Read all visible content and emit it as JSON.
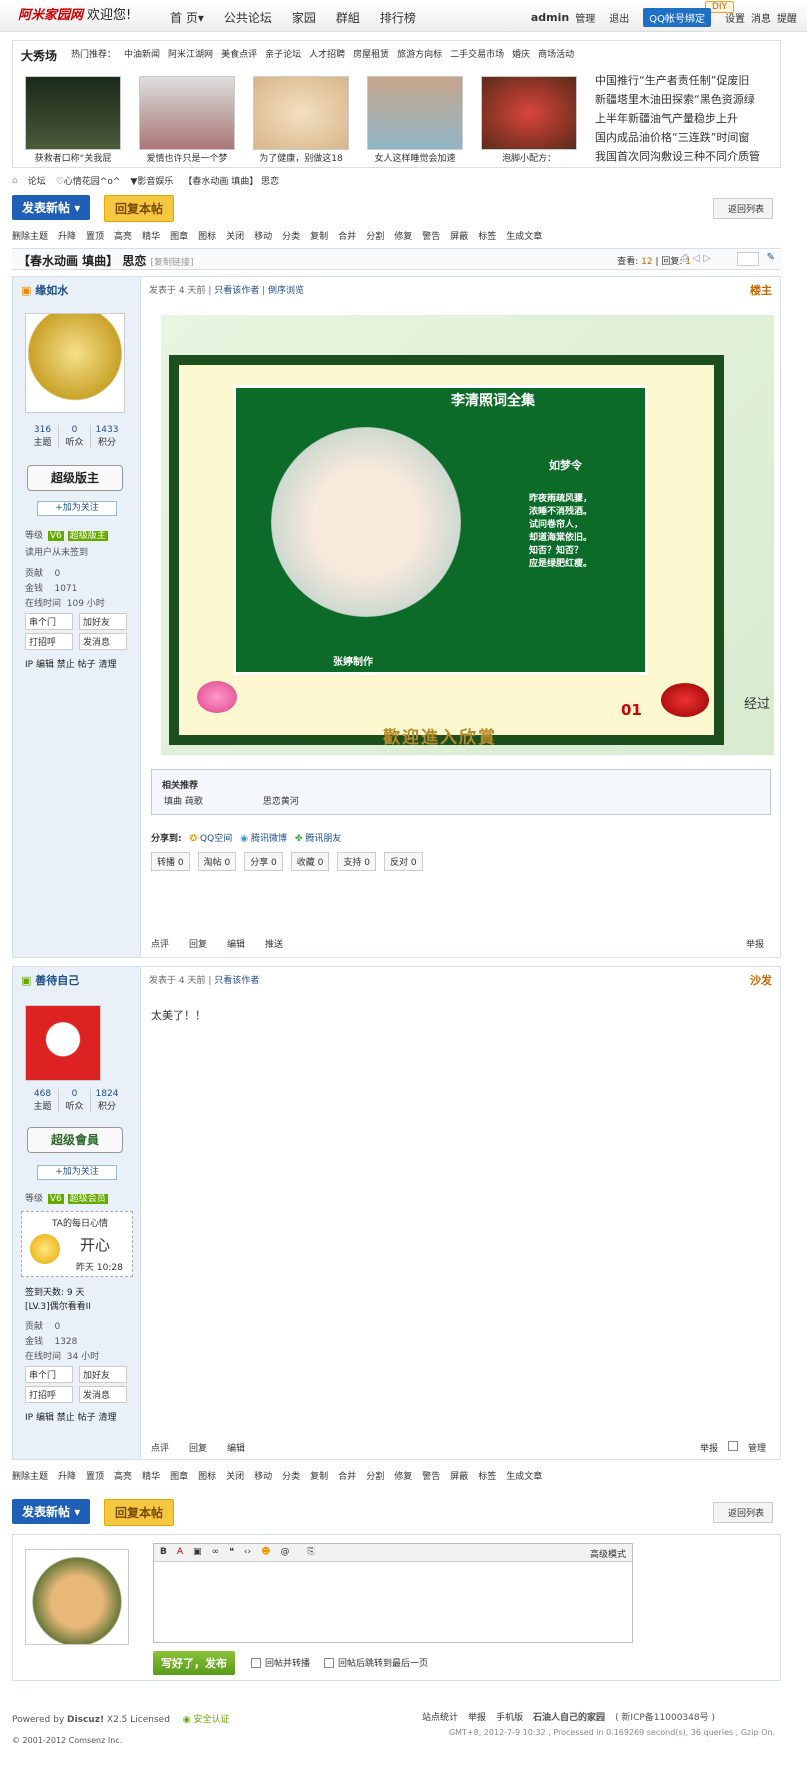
{
  "site": {
    "logo": "阿米家园网",
    "logo_url": "www.adjy.cn",
    "welcome": "欢迎您!"
  },
  "nav": [
    "首 页▾",
    "公共论坛",
    "家园",
    "群組",
    "排行榜"
  ],
  "user": {
    "name": "admin",
    "manage": "管理",
    "logout": "退出",
    "qq": "QQ帐号绑定",
    "diy": "DIY",
    "settings": "设置",
    "msg": "消息",
    "remind": "提醒"
  },
  "show": {
    "title": "大秀场",
    "hot_label": "热门推荐：",
    "hot": [
      "中油新闻",
      "阿米江湖网",
      "美食点评",
      "亲子论坛",
      "人才招聘",
      "房屋租赁",
      "旅游方向标",
      "二手交易市场",
      "婚庆",
      "商场活动"
    ],
    "thumbs": [
      "获救者口称“关我屁",
      "爱情也许只是一个梦",
      "为了健康，别做这18",
      "女人这样睡觉会加速",
      "泡脚小配方："
    ],
    "news": [
      "中国推行“生产者责任制”促废旧",
      "新疆塔里木油田探索“黑色资源绿",
      "上半年新疆油气产量稳步上升",
      "国内成品油价格“三连跌”时间窗",
      "我国首次同沟敷设三种不同介质管"
    ]
  },
  "crumb": [
    "论坛",
    "♡心情花园^o^",
    "▼影音娱乐",
    "【春水动画 填曲】 思恋"
  ],
  "buttons": {
    "new": "发表新帖",
    "reply": "回复本帖",
    "back": "返回列表"
  },
  "mod": [
    "删除主题",
    "升降",
    "置顶",
    "高亮",
    "精华",
    "图章",
    "图标",
    "关闭",
    "移动",
    "分类",
    "复制",
    "合并",
    "分割",
    "修复",
    "警告",
    "屏蔽",
    "标签",
    "生成文章"
  ],
  "thread": {
    "title": "【春水动画 填曲】 思恋",
    "copy": "[复制链接]",
    "view_label": "查看:",
    "views": "12",
    "reply_label": "回复:",
    "replies": "1"
  },
  "post1": {
    "author": "缘如水",
    "posts": "316",
    "fans": "0",
    "points": "1433",
    "stat_labels": [
      "主题",
      "听众",
      "积分"
    ],
    "badge": "超级版主",
    "follow": "+加为关注",
    "level": "等级",
    "vlevel": "V6",
    "group": "超级版主",
    "sign": "读用户从未签到",
    "contrib": "贡献",
    "contrib_v": "0",
    "money": "金钱",
    "money_v": "1071",
    "online": "在线时间",
    "online_v": "109 小时",
    "actions": [
      "串个门",
      "加好友",
      "打招呼",
      "发消息"
    ],
    "admin": "IP 编辑 禁止 帖子 清理",
    "posted": "发表于 4 天前",
    "only": "只看该作者",
    "rev": "倒序浏览",
    "floor": "楼主",
    "image": {
      "title": "李清照词全集",
      "poem_title": "如梦令",
      "poem": [
        "昨夜雨疏风骤，",
        "浓睡不消残酒。",
        "试问卷帘人，",
        "却道海棠依旧。",
        "知否？知否？",
        "应是绿肥红瘦。"
      ],
      "maker": "张婷制作",
      "num": "01",
      "welcome": "歡迎進入欣賞",
      "side": "经过"
    },
    "related_title": "相关推荐",
    "related": [
      "填曲 莼歌",
      "思恋黄河"
    ],
    "share_label": "分享到:",
    "share": [
      "QQ空间",
      "腾讯微博",
      "腾讯朋友"
    ],
    "share_btns": [
      "转播 0",
      "淘帖 0",
      "分享 0",
      "收藏 0",
      "支持 0",
      "反对 0"
    ],
    "foot": [
      "点评",
      "回复",
      "编辑",
      "推送"
    ],
    "report": "举报"
  },
  "post2": {
    "author": "善待自己",
    "posts": "468",
    "fans": "0",
    "points": "1824",
    "badge": "超级會員",
    "follow": "+加为关注",
    "level": "等级",
    "vlevel": "V6",
    "group": "超级会员",
    "mood_title": "TA的每日心情",
    "mood": "开心",
    "mood_time": "昨天 10:28",
    "signin": "签到天数: 9 天",
    "lv": "[LV.3]偶尔看看II",
    "contrib_v": "0",
    "money_v": "1328",
    "online_v": "34 小时",
    "posted": "发表于 4 天前",
    "only": "只看该作者",
    "floor": "沙发",
    "content": "太美了！！",
    "foot": [
      "点评",
      "回复",
      "编辑"
    ],
    "report": "举报",
    "manage": "管理"
  },
  "editor": {
    "advanced": "高级模式",
    "submit": "写好了，发布",
    "opt1": "回帖并转播",
    "opt2": "回帖后跳转到最后一页"
  },
  "footer": {
    "powered": "Powered by",
    "brand": "Discuz!",
    "ver": "X2.5 Licensed",
    "safe": "安全认证",
    "links": [
      "站点统计",
      "举报",
      "手机版"
    ],
    "site": "石油人自己的家园",
    "icp": "( 新ICP备11000348号 )",
    "copy": "© 2001-2012 Comsenz Inc.",
    "gmt": "GMT+8, 2012-7-9 10:32 , Processed in 0.169269 second(s), 36 queries , Gzip On."
  }
}
